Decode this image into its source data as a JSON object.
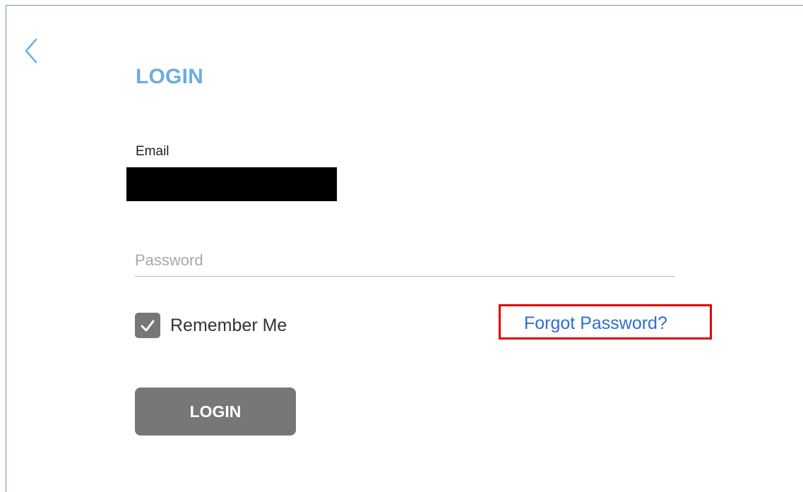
{
  "header": {
    "back_icon": "chevron-left-icon",
    "title": "LOGIN"
  },
  "form": {
    "email_label": "Email",
    "email_value": "",
    "password_placeholder": "Password",
    "password_value": "",
    "remember_label": "Remember Me",
    "remember_checked": true,
    "forgot_link": "Forgot Password?",
    "login_button": "LOGIN"
  },
  "colors": {
    "accent": "#6aaee0",
    "link": "#2b6fcf",
    "button": "#777777",
    "highlight_border": "#e00000",
    "frame_border": "#6c8fc7"
  }
}
